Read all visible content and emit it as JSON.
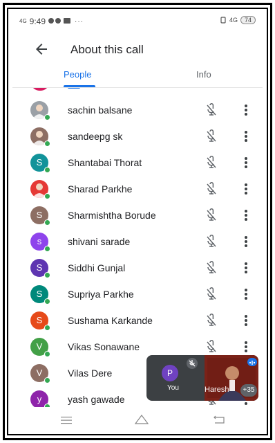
{
  "status_bar": {
    "signal": "4G",
    "time": "9:49",
    "dots": "···",
    "net": "4G",
    "battery": "74"
  },
  "app_bar": {
    "title": "About this call"
  },
  "tabs": [
    {
      "label": "People"
    },
    {
      "label": "Info"
    }
  ],
  "participants": [
    {
      "name": "sachin balsane",
      "initial": "",
      "color": "#9aa0a6",
      "icon": "profile-photo-avatar"
    },
    {
      "name": "sandeepg sk",
      "initial": "",
      "color": "#8d6e63",
      "icon": "profile-photo-avatar"
    },
    {
      "name": "Shantabai Thorat",
      "initial": "S",
      "color": "#12939a",
      "icon": "initial-avatar"
    },
    {
      "name": "Sharad Parkhe",
      "initial": "",
      "color": "#e53935",
      "icon": "profile-photo-avatar"
    },
    {
      "name": "Sharmishtha Borude",
      "initial": "S",
      "color": "#8d6e63",
      "icon": "initial-avatar"
    },
    {
      "name": "shivani sarade",
      "initial": "s",
      "color": "#8e44ec",
      "icon": "initial-avatar"
    },
    {
      "name": "Siddhi Gunjal",
      "initial": "S",
      "color": "#5e35b1",
      "icon": "initial-avatar"
    },
    {
      "name": "Supriya Parkhe",
      "initial": "S",
      "color": "#00897b",
      "icon": "initial-avatar"
    },
    {
      "name": "Sushama Karkande",
      "initial": "S",
      "color": "#e64a19",
      "icon": "initial-avatar"
    },
    {
      "name": "Vikas Sonawane",
      "initial": "V",
      "color": "#43a047",
      "icon": "initial-avatar"
    },
    {
      "name": "Vilas Dere",
      "initial": "V",
      "color": "#8d6e63",
      "icon": "initial-avatar"
    },
    {
      "name": "yash gawade",
      "initial": "y",
      "color": "#8e24aa",
      "icon": "initial-avatar"
    }
  ],
  "self_view": {
    "initial": "P",
    "label": "You",
    "presenter_name": "Haresh",
    "more_count": "+35"
  },
  "colors": {
    "accent": "#1a73e8",
    "presence": "#34a853"
  }
}
